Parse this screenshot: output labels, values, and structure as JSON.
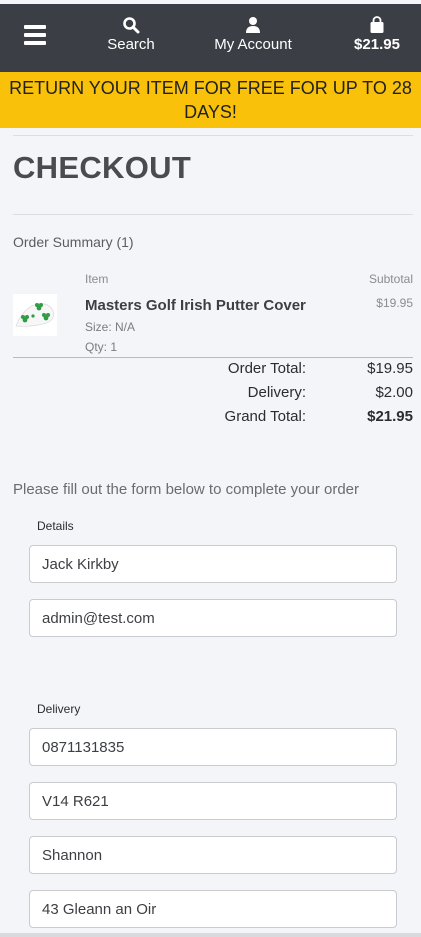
{
  "nav": {
    "search_label": "Search",
    "account_label": "My Account",
    "cart_total": "$21.95",
    "icons": {
      "menu": "hamburger-menu-icon",
      "search": "search-icon",
      "account": "user-icon",
      "cart": "shopping-bag-icon"
    }
  },
  "banner": {
    "text": "RETURN YOUR ITEM FOR FREE FOR UP TO 28 DAYS!"
  },
  "page_title": "CHECKOUT",
  "order_summary": {
    "heading": "Order Summary (1)",
    "col_item": "Item",
    "col_subtotal": "Subtotal",
    "items": [
      {
        "name": "Masters Golf Irish Putter Cover",
        "size": "Size: N/A",
        "qty": "Qty: 1",
        "price": "$19.95"
      }
    ],
    "totals": [
      {
        "label": "Order Total:",
        "value": "$19.95"
      },
      {
        "label": "Delivery:",
        "value": "$2.00"
      },
      {
        "label": "Grand Total:",
        "value": "$21.95"
      }
    ]
  },
  "form": {
    "intro": "Please fill out the form below to complete your order",
    "details_label": "Details",
    "full_name": "Jack Kirkby",
    "email": "admin@test.com",
    "delivery_label": "Delivery",
    "phone": "0871131835",
    "postcode": "V14 R621",
    "town": "Shannon",
    "street": "43 Gleann an Oir"
  },
  "colors": {
    "nav_bg": "#3b3f45",
    "banner_bg": "#f9c109",
    "page_bg": "#f4f5f8"
  }
}
